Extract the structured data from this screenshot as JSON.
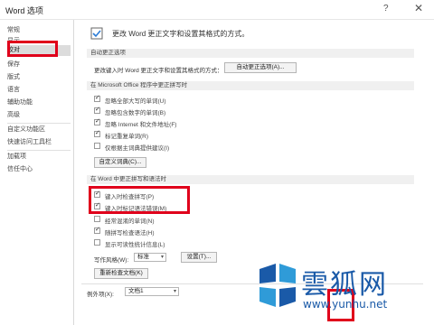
{
  "window": {
    "title": "Word 选项",
    "help": "?",
    "close": "✕"
  },
  "sidebar": {
    "items": [
      {
        "label": "常规"
      },
      {
        "label": "显示"
      },
      {
        "label": "校对"
      },
      {
        "label": "保存"
      },
      {
        "label": "版式"
      },
      {
        "label": "语言"
      },
      {
        "label": "辅助功能"
      },
      {
        "label": "高级"
      },
      {
        "label": "自定义功能区"
      },
      {
        "label": "快速访问工具栏"
      },
      {
        "label": "加载项"
      },
      {
        "label": "信任中心"
      }
    ],
    "selected_index": 2
  },
  "main": {
    "header": "更改 Word 更正文字和设置其格式的方式。",
    "autocorrect": {
      "section_title": "自动更正选项",
      "description": "更改键入时 Word 更正文字和设置其格式的方式：",
      "button": "自动更正选项(A)..."
    },
    "office": {
      "section_title": "在 Microsoft Office 程序中更正拼写时",
      "options": [
        {
          "label": "忽略全部大写的单词(U)",
          "checked": true
        },
        {
          "label": "忽略包含数字的单词(B)",
          "checked": true
        },
        {
          "label": "忽略 Internet 和文件地址(F)",
          "checked": true
        },
        {
          "label": "标记重复单词(R)",
          "checked": true
        },
        {
          "label": "仅根据主词典提供建议(I)",
          "checked": false
        }
      ],
      "dictionary_button": "自定义词典(C)..."
    },
    "word": {
      "section_title": "在 Word 中更正拼写和语法时",
      "options": [
        {
          "label": "键入时检查拼写(P)",
          "checked": true
        },
        {
          "label": "键入时标记语法错误(M)",
          "checked": true
        },
        {
          "label": "经常混淆的单词(N)",
          "checked": false
        },
        {
          "label": "随拼写检查语法(H)",
          "checked": true
        },
        {
          "label": "显示可读性统计信息(L)",
          "checked": false
        }
      ],
      "style_label": "写作风格(W):",
      "style_value": "标准",
      "settings_button": "设置(T)...",
      "recheck_button": "重新检查文档(K)"
    },
    "exceptions": {
      "label": "例外项(X):",
      "value": "文档1"
    }
  },
  "watermark": {
    "text": "雲狐网",
    "url": "www.yunhu.net"
  }
}
